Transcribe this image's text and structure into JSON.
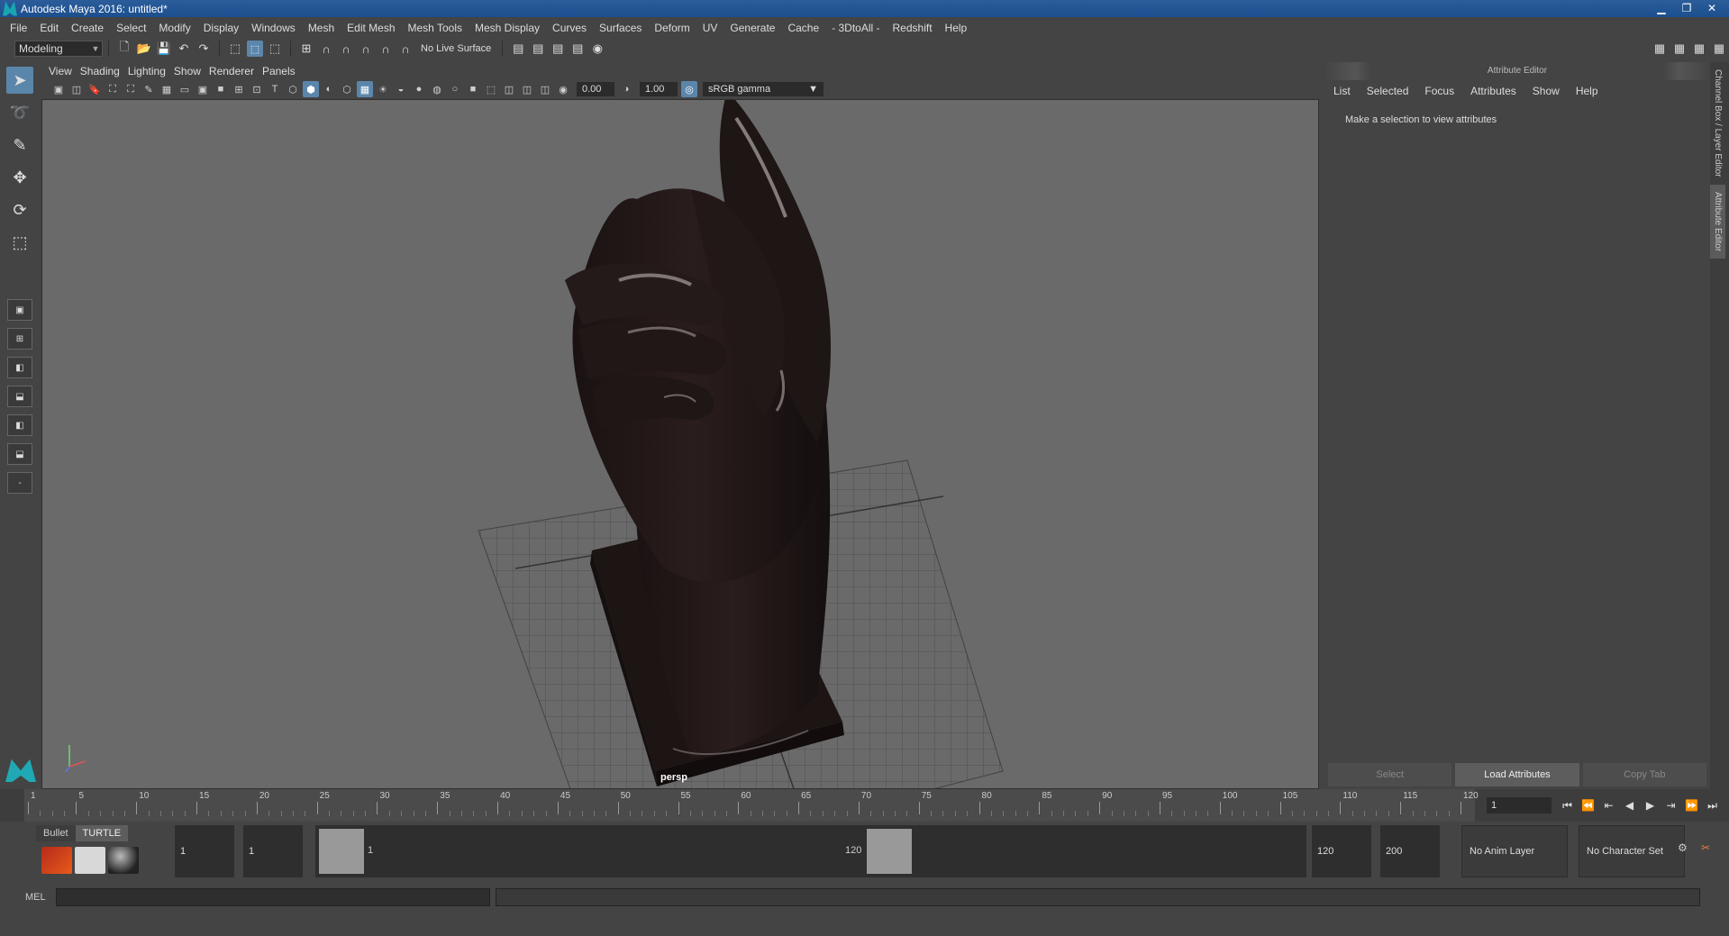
{
  "window": {
    "title": "Autodesk Maya 2016: untitled*",
    "controls": [
      "▁",
      "❐",
      "✕"
    ]
  },
  "menubar": [
    "File",
    "Edit",
    "Create",
    "Select",
    "Modify",
    "Display",
    "Windows",
    "Mesh",
    "Edit Mesh",
    "Mesh Tools",
    "Mesh Display",
    "Curves",
    "Surfaces",
    "Deform",
    "UV",
    "Generate",
    "Cache",
    "- 3DtoAll -",
    "Redshift",
    "Help"
  ],
  "statusline": {
    "mode": "Modeling",
    "live_surface": "No Live Surface"
  },
  "panel": {
    "menus": [
      "View",
      "Shading",
      "Lighting",
      "Show",
      "Renderer",
      "Panels"
    ],
    "exposure": "0.00",
    "gamma": "1.00",
    "colorspace": "sRGB gamma",
    "camera": "persp"
  },
  "attribute_editor": {
    "title": "Attribute Editor",
    "menus": [
      "List",
      "Selected",
      "Focus",
      "Attributes",
      "Show",
      "Help"
    ],
    "message": "Make a selection to view attributes",
    "buttons": [
      "Select",
      "Load Attributes",
      "Copy Tab"
    ]
  },
  "side_tabs": [
    "Channel Box / Layer Editor",
    "Attribute Editor"
  ],
  "timeline": {
    "labels": [
      "1",
      "5",
      "10",
      "15",
      "20",
      "25",
      "30",
      "35",
      "40",
      "45",
      "50",
      "55",
      "60",
      "65",
      "70",
      "75",
      "80",
      "85",
      "90",
      "95",
      "100",
      "105",
      "110",
      "115",
      "120"
    ],
    "current_frame": "1",
    "start": 1,
    "end": 120
  },
  "range": {
    "start_field": "1",
    "inner_start_field": "1",
    "range_start_label": "1",
    "range_end_label": "120",
    "end_field": "120",
    "anim_end_field": "200",
    "anim_layer": "No Anim Layer",
    "character_set": "No Character Set"
  },
  "shelf": {
    "tabs": [
      "Bullet",
      "TURTLE"
    ]
  },
  "command_line": {
    "label": "MEL"
  }
}
